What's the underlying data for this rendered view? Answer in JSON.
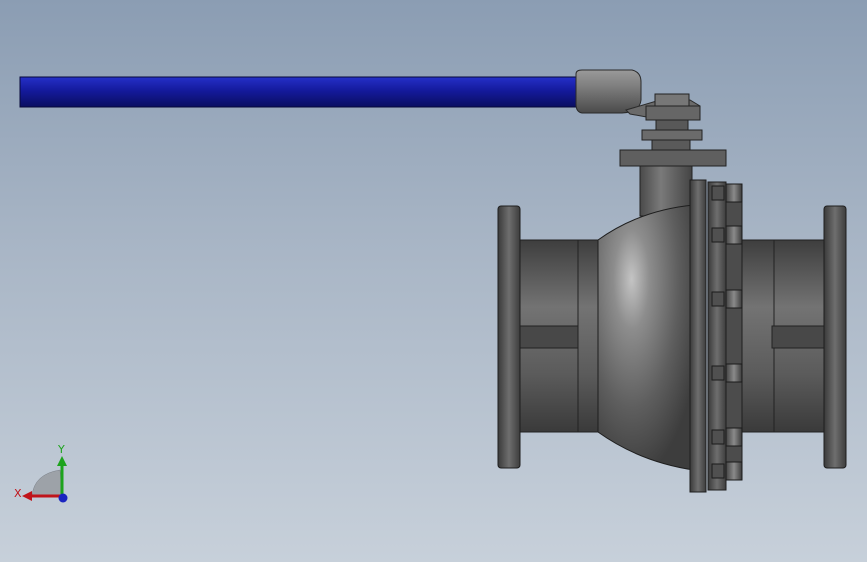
{
  "viewport": {
    "background_top": "#8b9db3",
    "background_bottom": "#c7d0da"
  },
  "model": {
    "part": "ball-valve",
    "handle_color": "#141a9c",
    "body_color": "#5a5a5a"
  },
  "triad": {
    "x_label": "X",
    "y_label": "Y",
    "x_color": "#c0141a",
    "y_color": "#1da31d",
    "z_color": "#1a24c0"
  }
}
